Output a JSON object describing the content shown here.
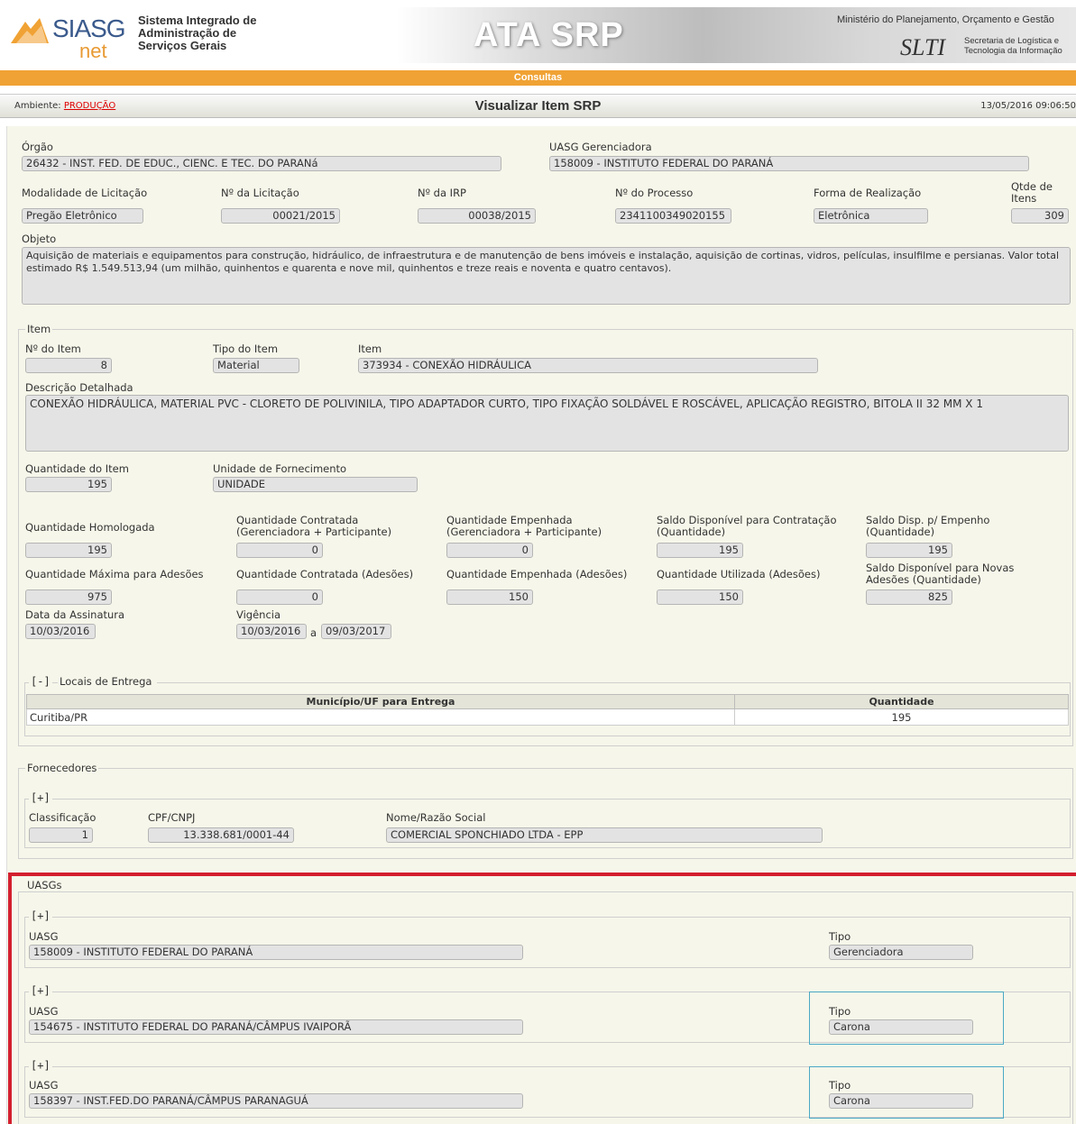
{
  "header": {
    "logo_main": "SIASG",
    "logo_sub": "net",
    "system_title": [
      "Sistema Integrado de",
      "Administração de",
      "Serviços Gerais"
    ],
    "banner_title": "ATA SRP",
    "ministry": "Ministério do Planejamento, Orçamento e Gestão",
    "slti": "SLTI",
    "slti_text": [
      "Secretaria de Logística e",
      "Tecnologia da Informação"
    ]
  },
  "menu": {
    "consultas": "Consultas"
  },
  "titlebar": {
    "env_label": "Ambiente:",
    "env_value": "PRODUÇÃO",
    "title": "Visualizar Item SRP",
    "datetime": "13/05/2016 09:06:50"
  },
  "ata": {
    "orgao_label": "Órgão",
    "orgao": "26432 - INST. FED. DE EDUC., CIENC. E TEC. DO PARANá",
    "uasg_ger_label": "UASG Gerenciadora",
    "uasg_ger": "158009 - INSTITUTO FEDERAL DO PARANÁ",
    "modalidade_label": "Modalidade de Licitação",
    "modalidade": "Pregão Eletrônico",
    "licitacao_label": "Nº da Licitação",
    "licitacao": "00021/2015",
    "irp_label": "Nº da IRP",
    "irp": "00038/2015",
    "processo_label": "Nº do Processo",
    "processo": "23411003490201​55",
    "forma_label": "Forma de Realização",
    "forma": "Eletrônica",
    "qtde_itens_label": "Qtde de Itens",
    "qtde_itens": "309",
    "objeto_label": "Objeto",
    "objeto": "Aquisição de materiais e equipamentos para construção, hidráulico, de infraestrutura e de manutenção de bens imóveis e instalação, aquisição de cortinas, vidros, películas, insulfilme e persianas. Valor total estimado R$ 1.549.513,94 (um milhão, quinhentos e quarenta e nove mil, quinhentos e treze reais e noventa e quatro centavos)."
  },
  "item": {
    "legend": "Item",
    "num_label": "Nº do Item",
    "num": "8",
    "tipo_label": "Tipo do Item",
    "tipo": "Material",
    "item_label": "Item",
    "item": "373934 - CONEXÃO HIDRÁULICA",
    "desc_label": "Descrição Detalhada",
    "desc": "CONEXÃO HIDRÁULICA, MATERIAL PVC - CLORETO DE POLIVINILA, TIPO ADAPTADOR CURTO, TIPO FIXAÇÃO SOLDÁVEL E ROSCÁVEL, APLICAÇÃO REGISTRO, BITOLA II 32 MM X 1",
    "qtd_item_label": "Quantidade do Item",
    "qtd_item": "195",
    "unidade_label": "Unidade de Fornecimento",
    "unidade": "UNIDADE",
    "qtd_homologada_label": "Quantidade Homologada",
    "qtd_homologada": "195",
    "qtd_contratada_label": "Quantidade Contratada (Gerenciadora + Participante)",
    "qtd_contratada": "0",
    "qtd_empenhada_label": "Quantidade Empenhada (Gerenciadora + Participante)",
    "qtd_empenhada": "0",
    "saldo_contratacao_label": "Saldo Disponível para Contratação (Quantidade)",
    "saldo_contratacao": "195",
    "saldo_empenho_label": "Saldo Disp. p/ Empenho (Quantidade)",
    "saldo_empenho": "195",
    "qtd_max_adesoes_label": "Quantidade Máxima para Adesões",
    "qtd_max_adesoes": "975",
    "qtd_contratada_adesoes_label": "Quantidade Contratada (Adesões)",
    "qtd_contratada_adesoes": "0",
    "qtd_empenhada_adesoes_label": "Quantidade Empenhada (Adesões)",
    "qtd_empenhada_adesoes": "150",
    "qtd_utilizada_label": "Quantidade Utilizada (Adesões)",
    "qtd_utilizada": "150",
    "saldo_adesoes_label": "Saldo Disponível para Novas Adesões (Quantidade)",
    "saldo_adesoes": "825",
    "data_assinatura_label": "Data da Assinatura",
    "data_assinatura": "10/03/2016",
    "vigencia_label": "Vigência",
    "vigencia_inicio": "10/03/2016",
    "vigencia_sep": "a",
    "vigencia_fim": "09/03/2017"
  },
  "locais": {
    "toggle": "[-]",
    "legend": "Locais de Entrega",
    "col_municipio": "Município/UF para Entrega",
    "col_quantidade": "Quantidade",
    "rows": [
      {
        "municipio": "Curitiba/PR",
        "quantidade": "195"
      }
    ]
  },
  "fornecedores": {
    "legend": "Fornecedores",
    "toggle": "[+]",
    "classificacao_label": "Classificação",
    "classificacao": "1",
    "cnpj_label": "CPF/CNPJ",
    "cnpj": "13.338.681/0001-44",
    "nome_label": "Nome/Razão Social",
    "nome": "COMERCIAL SPONCHIADO LTDA - EPP"
  },
  "uasgs": {
    "legend": "UASGs",
    "uasg_label": "UASG",
    "tipo_label": "Tipo",
    "toggle": "[+]",
    "items": [
      {
        "uasg": "158009 - INSTITUTO FEDERAL DO PARANÁ",
        "tipo": "Gerenciadora"
      },
      {
        "uasg": "154675 - INSTITUTO FEDERAL DO PARANÁ/CÂMPUS IVAIPORÃ",
        "tipo": "Carona"
      },
      {
        "uasg": "158397 - INST.FED.DO PARANÁ/CÂMPUS PARANAGUÁ",
        "tipo": "Carona"
      }
    ]
  },
  "colors": {
    "accent_orange": "#f0a234",
    "highlight_red": "#d31f2e",
    "highlight_cyan": "#4aa9c6"
  }
}
